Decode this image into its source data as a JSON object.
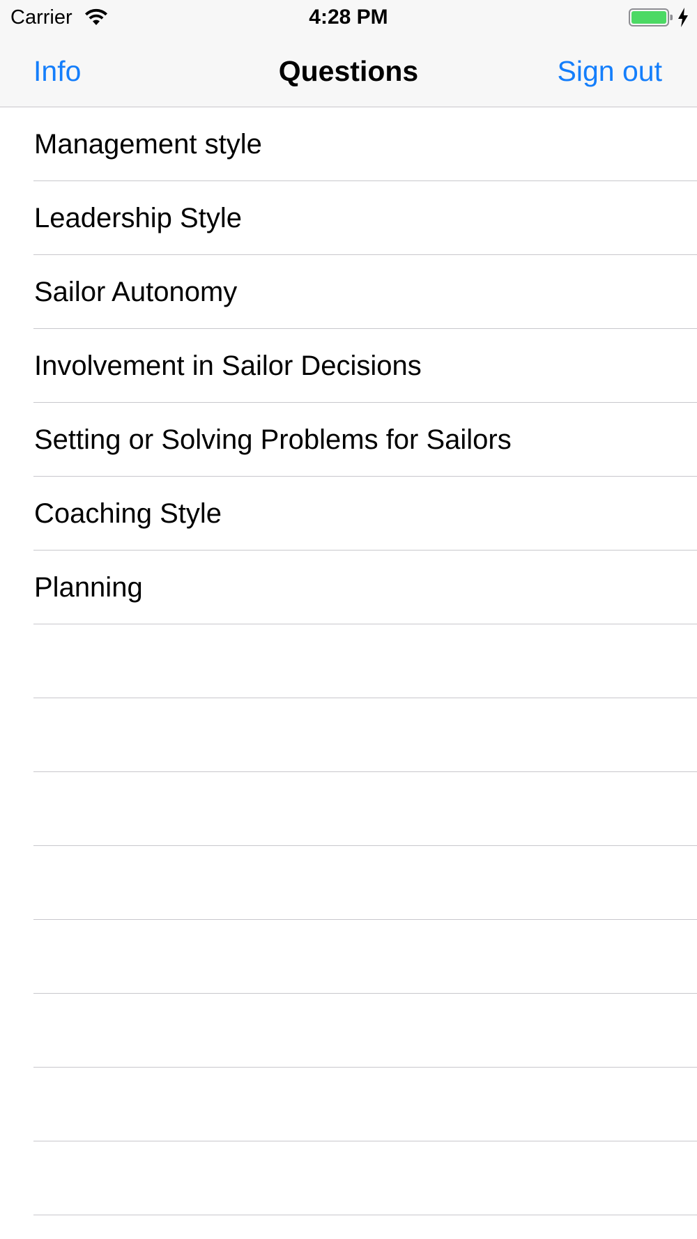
{
  "status_bar": {
    "carrier": "Carrier",
    "time": "4:28 PM",
    "icons": [
      "wifi-icon",
      "battery-icon",
      "charging-icon"
    ],
    "battery_color": "#4cd964"
  },
  "nav_bar": {
    "left_button": "Info",
    "title": "Questions",
    "right_button": "Sign out",
    "tint_color": "#147efb"
  },
  "questions": [
    {
      "label": "Management style"
    },
    {
      "label": "Leadership Style"
    },
    {
      "label": "Sailor Autonomy"
    },
    {
      "label": "Involvement in Sailor Decisions"
    },
    {
      "label": "Setting or Solving Problems for Sailors"
    },
    {
      "label": "Coaching Style"
    },
    {
      "label": "Planning"
    }
  ]
}
